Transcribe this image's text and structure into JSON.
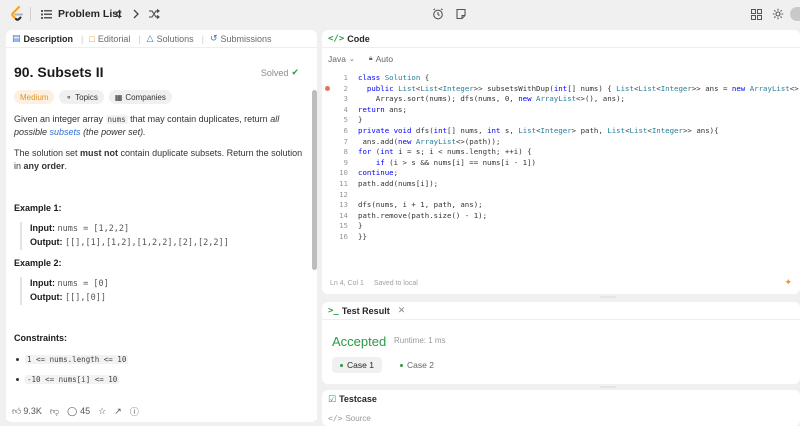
{
  "topbar": {
    "problem_list": "Problem List"
  },
  "left_tabs": {
    "description": "Description",
    "editorial": "Editorial",
    "solutions": "Solutions",
    "submissions": "Submissions"
  },
  "problem": {
    "title": "90. Subsets II",
    "status": "Solved",
    "difficulty": "Medium",
    "topics": "Topics",
    "companies": "Companies",
    "desc1_a": "Given an integer array ",
    "desc1_code": "nums",
    "desc1_b": " that may contain duplicates, return ",
    "desc1_c": "all possible ",
    "desc1_link": "subsets",
    "desc1_d": " (the power set).",
    "desc2_a": "The solution set ",
    "desc2_b": "must not",
    "desc2_c": " contain duplicate subsets. Return the solution in ",
    "desc2_d": "any order",
    "desc2_e": ".",
    "example1_title": "Example 1:",
    "example1_input_label": "Input:",
    "example1_input": "nums = [1,2,2]",
    "example1_output_label": "Output:",
    "example1_output": "[[],[1],[1,2],[1,2,2],[2],[2,2]]",
    "example2_title": "Example 2:",
    "example2_input_label": "Input:",
    "example2_input": "nums = [0]",
    "example2_output_label": "Output:",
    "example2_output": "[[],[0]]",
    "constraints_title": "Constraints:",
    "constraint1": "1 <= nums.length <= 10",
    "constraint2": "-10 <= nums[i] <= 10"
  },
  "bottom": {
    "likes": "9.3K",
    "comments": "45"
  },
  "code_panel": {
    "title": "Code",
    "language": "Java",
    "auto": "Auto",
    "status_pos": "Ln 4, Col 1",
    "status_saved": "Saved to local"
  },
  "code_lines": [
    "class Solution {",
    "  public List<List<Integer>> subsetsWithDup(int[] nums) { List<List<Integer>> ans = new ArrayList<>();",
    "    Arrays.sort(nums); dfs(nums, 0, new ArrayList<>(), ans);",
    "return ans;",
    "}",
    "private void dfs(int[] nums, int s, List<Integer> path, List<List<Integer>> ans){",
    " ans.add(new ArrayList<>(path));",
    "for (int i = s; i < nums.length; ++i) {",
    "    if (i > s && nums[i] == nums[i - 1])",
    "continue;",
    "path.add(nums[i]);",
    "",
    "dfs(nums, i + 1, path, ans);",
    "path.remove(path.size() - 1);",
    "}",
    "}}"
  ],
  "result_panel": {
    "title": "Test Result",
    "verdict": "Accepted",
    "runtime": "Runtime: 1 ms",
    "case1": "Case 1",
    "case2": "Case 2"
  },
  "testcase_panel": {
    "title": "Testcase",
    "source": "Source"
  }
}
